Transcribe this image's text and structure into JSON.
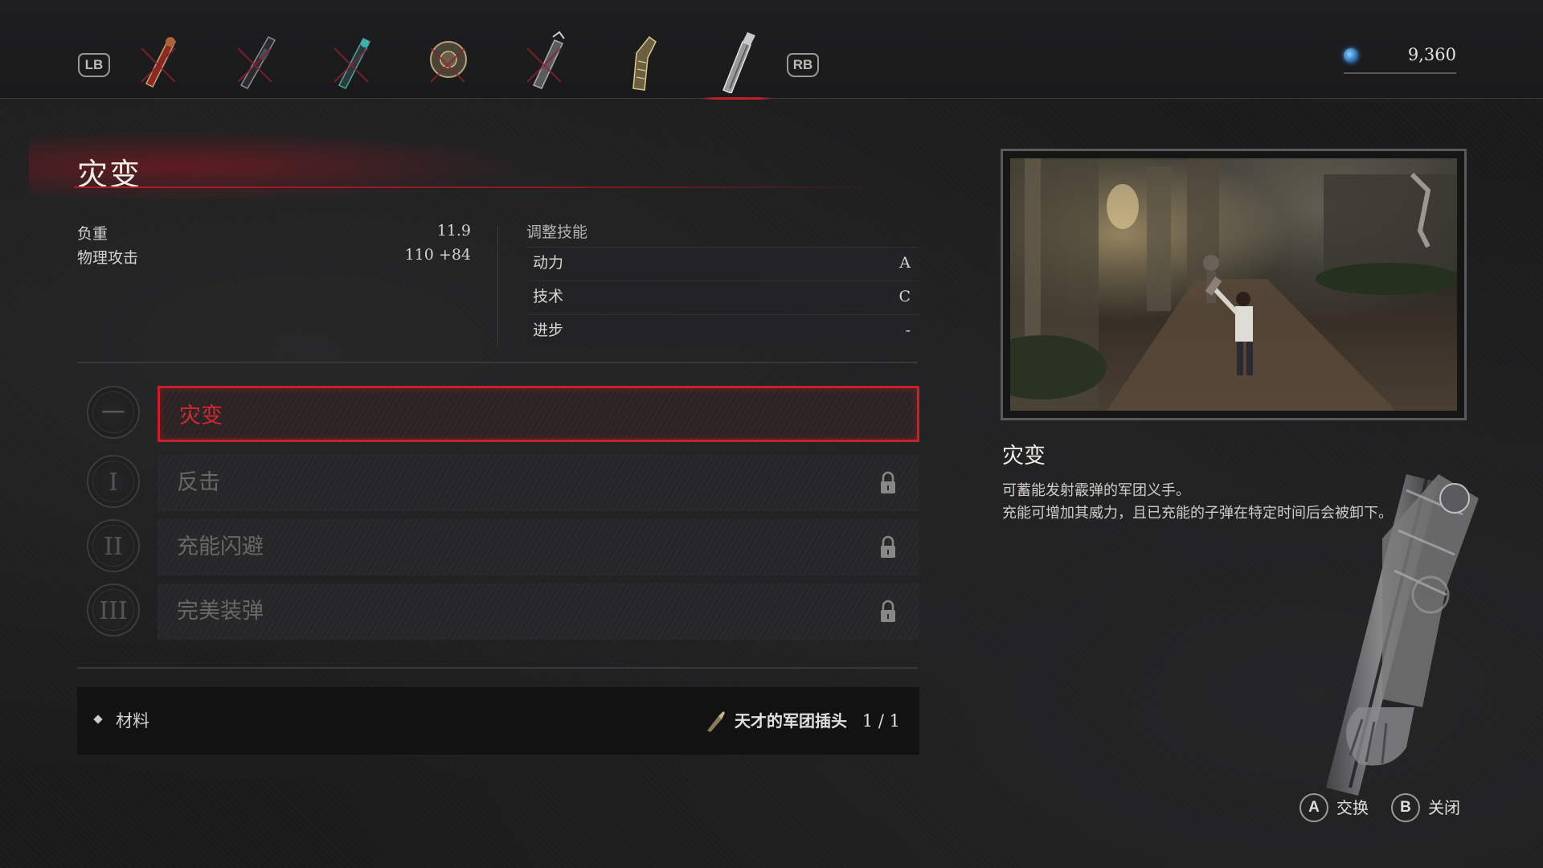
{
  "top_bar": {
    "lb_label": "LB",
    "rb_label": "RB",
    "weapon_tabs": [
      {
        "icon": "crossed-fire-arm-icon"
      },
      {
        "icon": "crossed-rifle-arm-icon"
      },
      {
        "icon": "crossed-flame-arm-icon"
      },
      {
        "icon": "crossed-shield-arm-icon"
      },
      {
        "icon": "crossed-claw-arm-icon"
      },
      {
        "icon": "gauntlet-arm-icon"
      },
      {
        "icon": "shotgun-arm-icon",
        "active": true
      }
    ],
    "currency_icon": "ergo-gem-icon",
    "currency_amount": "9,360"
  },
  "weapon": {
    "name": "灾变",
    "stats": [
      {
        "label": "负重",
        "value": "11.9"
      },
      {
        "label": "物理攻击",
        "value": "110 +84"
      }
    ],
    "scaling_header": "调整技能",
    "scaling": [
      {
        "label": "动力",
        "grade": "A"
      },
      {
        "label": "技术",
        "grade": "C"
      },
      {
        "label": "进步",
        "grade": "-"
      }
    ]
  },
  "skills": [
    {
      "medal": "一",
      "name": "灾变",
      "locked": false,
      "selected": true
    },
    {
      "medal": "I",
      "name": "反击",
      "locked": true,
      "selected": false
    },
    {
      "medal": "II",
      "name": "充能闪避",
      "locked": true,
      "selected": false
    },
    {
      "medal": "III",
      "name": "完美装弹",
      "locked": true,
      "selected": false
    }
  ],
  "materials": {
    "label": "材料",
    "item_icon": "legion-plug-icon",
    "item_name": "天才的军团插头",
    "count": "1 / 1"
  },
  "detail": {
    "title": "灾变",
    "lines": [
      "可蓄能发射霰弹的军团义手。",
      "充能可增加其威力，且已充能的子弹在特定时间后会被卸下。"
    ]
  },
  "footer_hints": [
    {
      "button": "A",
      "label": "交换"
    },
    {
      "button": "B",
      "label": "关闭"
    }
  ],
  "colors": {
    "accent_red": "#c8202b",
    "background": "#1b1b1c"
  }
}
